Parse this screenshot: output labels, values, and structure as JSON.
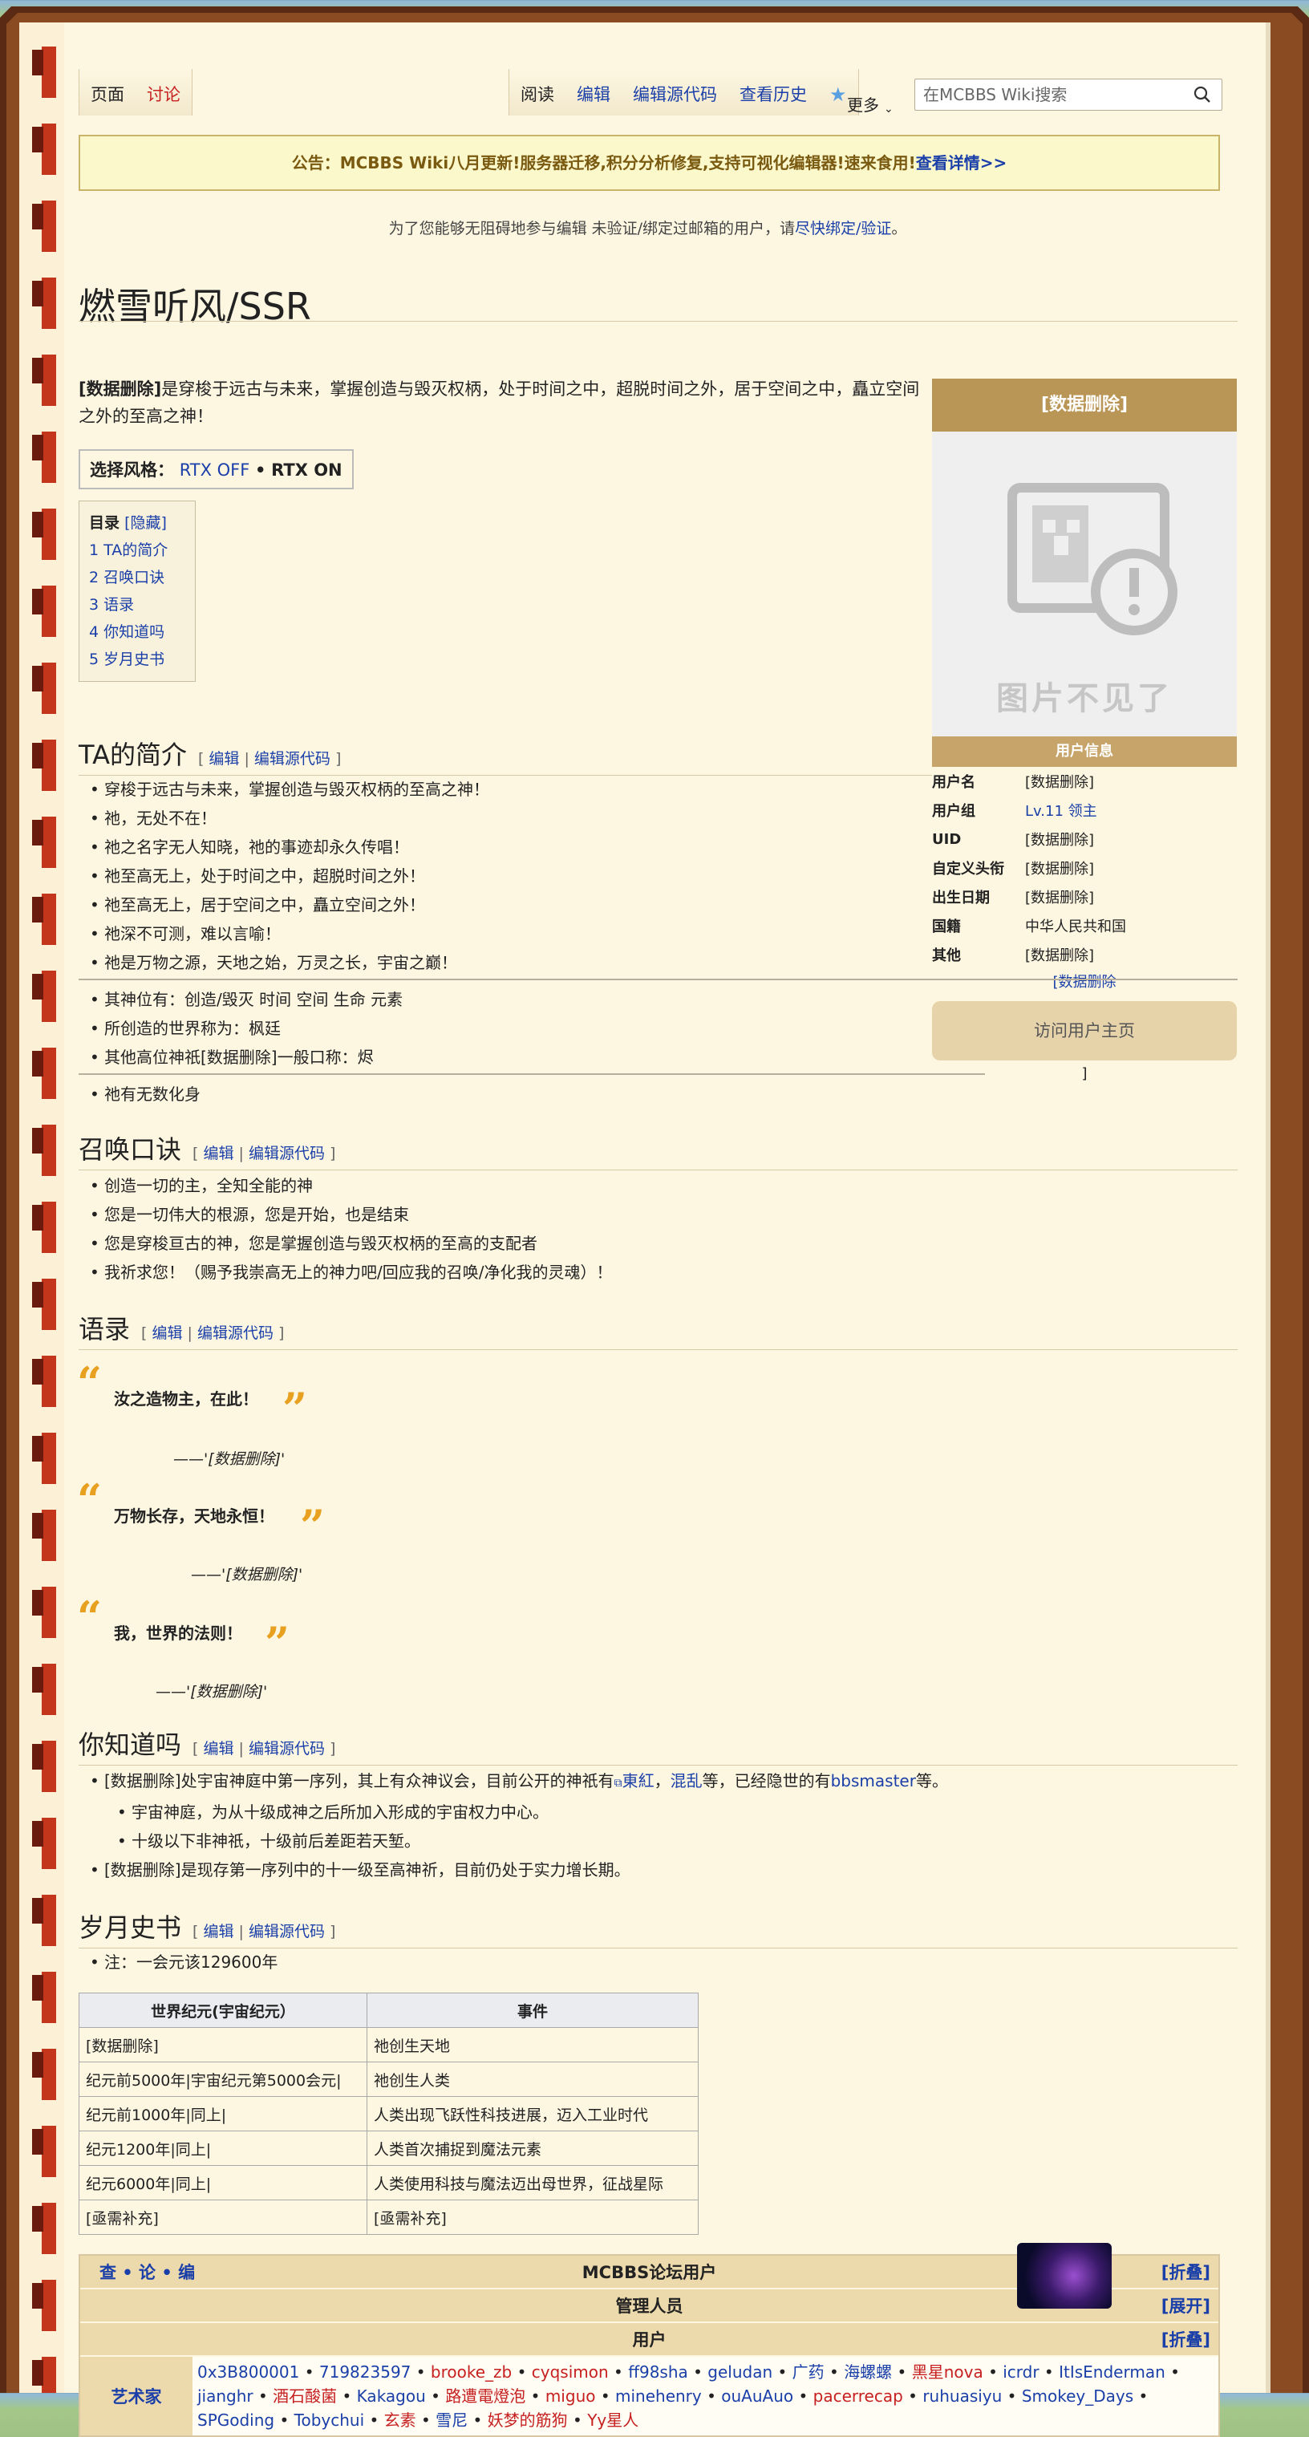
{
  "tabs_left": [
    "页面",
    "讨论"
  ],
  "tabs_right": [
    "阅读",
    "编辑",
    "编辑源代码",
    "查看历史"
  ],
  "more_label": "更多",
  "search_placeholder": "在MCBBS Wiki搜索",
  "notice": {
    "text": "公告：MCBBS Wiki八月更新!服务器迁移,积分分析修复,支持可视化编辑器!速来食用!",
    "link": "查看详情>>"
  },
  "sitenote": {
    "text": "为了您能够无阻碍地参与编辑 未验证/绑定过邮箱的用户，请",
    "link": "尽快绑定/验证",
    "end": "。"
  },
  "title": "燃雪听风/SSR",
  "intro": {
    "bold": "[数据删除]",
    "text": "是穿梭于远古与未来，掌握创造与毁灭权柄，处于时间之中，超脱时间之外，居于空间之中，矗立空间之外的至高之神！"
  },
  "style_switch": {
    "label": "选择风格：",
    "off": "RTX OFF",
    "sep": "•",
    "on": "RTX ON"
  },
  "toc": {
    "title": "目录",
    "hide": "[隐藏]",
    "items": [
      "1  TA的简介",
      "2  召唤口诀",
      "3  语录",
      "4  你知道吗",
      "5  岁月史书"
    ]
  },
  "edit_links": {
    "edit": "编辑",
    "source": "编辑源代码"
  },
  "sections": {
    "intro": "TA的简介",
    "summon": "召唤口诀",
    "quotes": "语录",
    "didyouknow": "你知道吗",
    "history": "岁月史书"
  },
  "intro_list_a": [
    "穿梭于远古与未来，掌握创造与毁灭权柄的至高之神！",
    "祂，无处不在！",
    "祂之名字无人知晓，祂的事迹却永久传唱！",
    "祂至高无上，处于时间之中，超脱时间之外！",
    "祂至高无上，居于空间之中，矗立空间之外！",
    "祂深不可测，难以言喻！",
    "祂是万物之源，天地之始，万灵之长，宇宙之巅！"
  ],
  "intro_list_b": [
    "其神位有：创造/毁灭 时间 空间 生命 元素",
    "所创造的世界称为：枫廷",
    "其他高位神祇[数据删除]一般口称：烬"
  ],
  "intro_list_c": [
    "祂有无数化身"
  ],
  "summon_list": [
    "创造一切的主，全知全能的神",
    "您是一切伟大的根源，您是开始，也是结束",
    "您是穿梭亘古的神，您是掌握创造与毁灭权柄的至高的支配者",
    "我祈求您！（赐予我崇高无上的神力吧/回应我的召唤/净化我的灵魂）！"
  ],
  "quotes": [
    {
      "text": "汝之造物主，在此！",
      "by": "——'[数据删除]'"
    },
    {
      "text": "万物长存，天地永恒！",
      "by": "——'[数据删除]'"
    },
    {
      "text": "我，世界的法则！",
      "by": "——'[数据删除]'"
    }
  ],
  "dyk": {
    "line1_a": "[数据删除]处宇宙神庭中第一序列，其上有众神议会，目前公开的神祇有",
    "line1_l1": "東紅",
    "line1_sep": "，",
    "line1_l2": "混乱",
    "line1_b": "等，已经隐世的有",
    "line1_l3": "bbsmaster",
    "line1_c": "等。",
    "sub": [
      "宇宙神庭，为从十级成神之后所加入形成的宇宙权力中心。",
      "十级以下非神祇，十级前后差距若天堑。"
    ],
    "line2": "[数据删除]是现存第一序列中的十一级至高神祈，目前仍处于实力增长期。"
  },
  "history_note": "注：一会元该129600年",
  "history_table": {
    "headers": [
      "世界纪元(宇宙纪元）",
      "事件"
    ],
    "rows": [
      [
        "[数据删除]",
        "祂创生天地"
      ],
      [
        "纪元前5000年|宇宙纪元第5000会元|",
        "祂创生人类"
      ],
      [
        "纪元前1000年|同上|",
        "人类出现飞跃性科技进展，迈入工业时代"
      ],
      [
        "纪元1200年|同上|",
        "人类首次捕捉到魔法元素"
      ],
      [
        "纪元6000年|同上|",
        "人类使用科技与魔法迈出母世界，征战星际"
      ],
      [
        "[亟需补充]",
        "[亟需补充]"
      ]
    ]
  },
  "infobox": {
    "title": "[数据删除]",
    "img_text": "图片不见了",
    "sub": "用户信息",
    "rows": [
      {
        "k": "用户名",
        "v": "[数据删除]"
      },
      {
        "k": "用户组",
        "v": "Lv.11 领主"
      },
      {
        "k": "UID",
        "v": "[数据删除]"
      },
      {
        "k": "自定义头衔",
        "v": "[数据删除]"
      },
      {
        "k": "出生日期",
        "v": "[数据删除]"
      },
      {
        "k": "国籍",
        "v": "中华人民共和国"
      },
      {
        "k": "其他",
        "v": "[数据删除]"
      }
    ],
    "extra": "[数据删除",
    "button": "访问用户主页",
    "tail": "]"
  },
  "navbox": {
    "vte": "查 • 论 • 编",
    "title": "MCBBS论坛用户",
    "fold": "[折叠]",
    "admins": "管理人员",
    "expand": "[展开]",
    "users": "用户",
    "group_label": "艺术家",
    "names": [
      "0x3B800001",
      "719823597",
      "brooke_zb",
      "cyqsimon",
      "ff98sha",
      "geludan",
      "广药",
      "海螺螺",
      "黑星nova",
      "icrdr",
      "ItIsEnderman",
      "jianghr",
      "酒石酸菌",
      "Kakagou",
      "路遭電燈泡",
      "miguo",
      "minehenry",
      "ouAuAuo",
      "pacerrecap",
      "ruhuasiyu",
      "Smokey_Days",
      "SPGoding",
      "Tobychui",
      "玄素",
      "雪尼",
      "妖梦的筋狗",
      "Yy星人"
    ],
    "red_names": [
      "brooke_zb",
      "cyqsimon",
      "黑星nova",
      "酒石酸菌",
      "路遭電燈泡",
      "miguo",
      "pacerrecap",
      "玄素",
      "妖梦的筋狗",
      "Yy星人"
    ]
  }
}
